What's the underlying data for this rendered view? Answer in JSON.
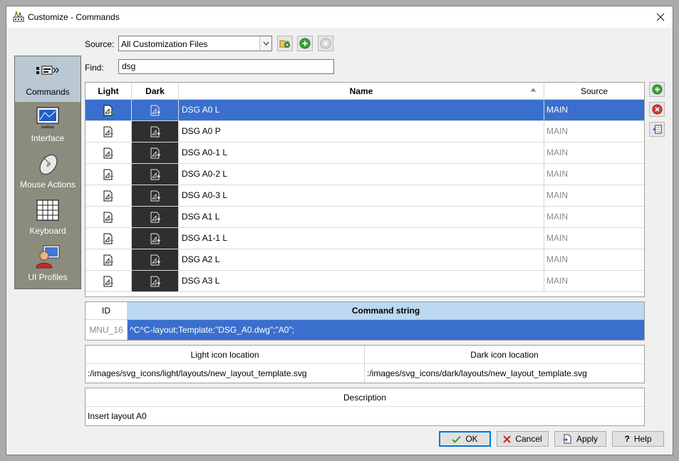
{
  "window": {
    "title": "Customize - Commands",
    "close_label": "×"
  },
  "nav": [
    {
      "label": "Commands",
      "icon": "commands-icon",
      "active": true
    },
    {
      "label": "Interface",
      "icon": "monitor-icon"
    },
    {
      "label": "Mouse Actions",
      "icon": "mouse-icon"
    },
    {
      "label": "Keyboard",
      "icon": "keyboard-icon"
    },
    {
      "label": "UI Profiles",
      "icon": "user-profile-icon"
    }
  ],
  "source": {
    "label": "Source:",
    "value": "All Customization Files"
  },
  "find": {
    "label": "Find:",
    "value": "dsg"
  },
  "grid": {
    "headers": {
      "light": "Light",
      "dark": "Dark",
      "name": "Name",
      "source": "Source"
    },
    "rows": [
      {
        "name": "DSG A0 L",
        "source": "MAIN",
        "selected": true
      },
      {
        "name": "DSG A0 P",
        "source": "MAIN"
      },
      {
        "name": "DSG A0-1 L",
        "source": "MAIN"
      },
      {
        "name": "DSG A0-2 L",
        "source": "MAIN"
      },
      {
        "name": "DSG A0-3 L",
        "source": "MAIN"
      },
      {
        "name": "DSG A1 L",
        "source": "MAIN"
      },
      {
        "name": "DSG A1-1 L",
        "source": "MAIN"
      },
      {
        "name": "DSG A2 L",
        "source": "MAIN"
      },
      {
        "name": "DSG A3 L",
        "source": "MAIN"
      }
    ]
  },
  "command": {
    "id_header": "ID",
    "string_header": "Command string",
    "id": "MNU_16",
    "string": "^C^C-layout;Template;\"DSG_A0.dwg\";\"A0\";"
  },
  "icons": {
    "light_header": "Light icon location",
    "dark_header": "Dark icon location",
    "light_path": ":/images/svg_icons/light/layouts/new_layout_template.svg",
    "dark_path": ":/images/svg_icons/dark/layouts/new_layout_template.svg"
  },
  "description": {
    "header": "Description",
    "value": "Insert layout A0"
  },
  "buttons": {
    "ok": "OK",
    "cancel": "Cancel",
    "apply": "Apply",
    "help": "Help"
  },
  "colors": {
    "selection": "#3a6fce",
    "header_highlight": "#bcd9f1",
    "nav_bg": "#8b8b7e",
    "nav_active": "#b9c8d2"
  }
}
